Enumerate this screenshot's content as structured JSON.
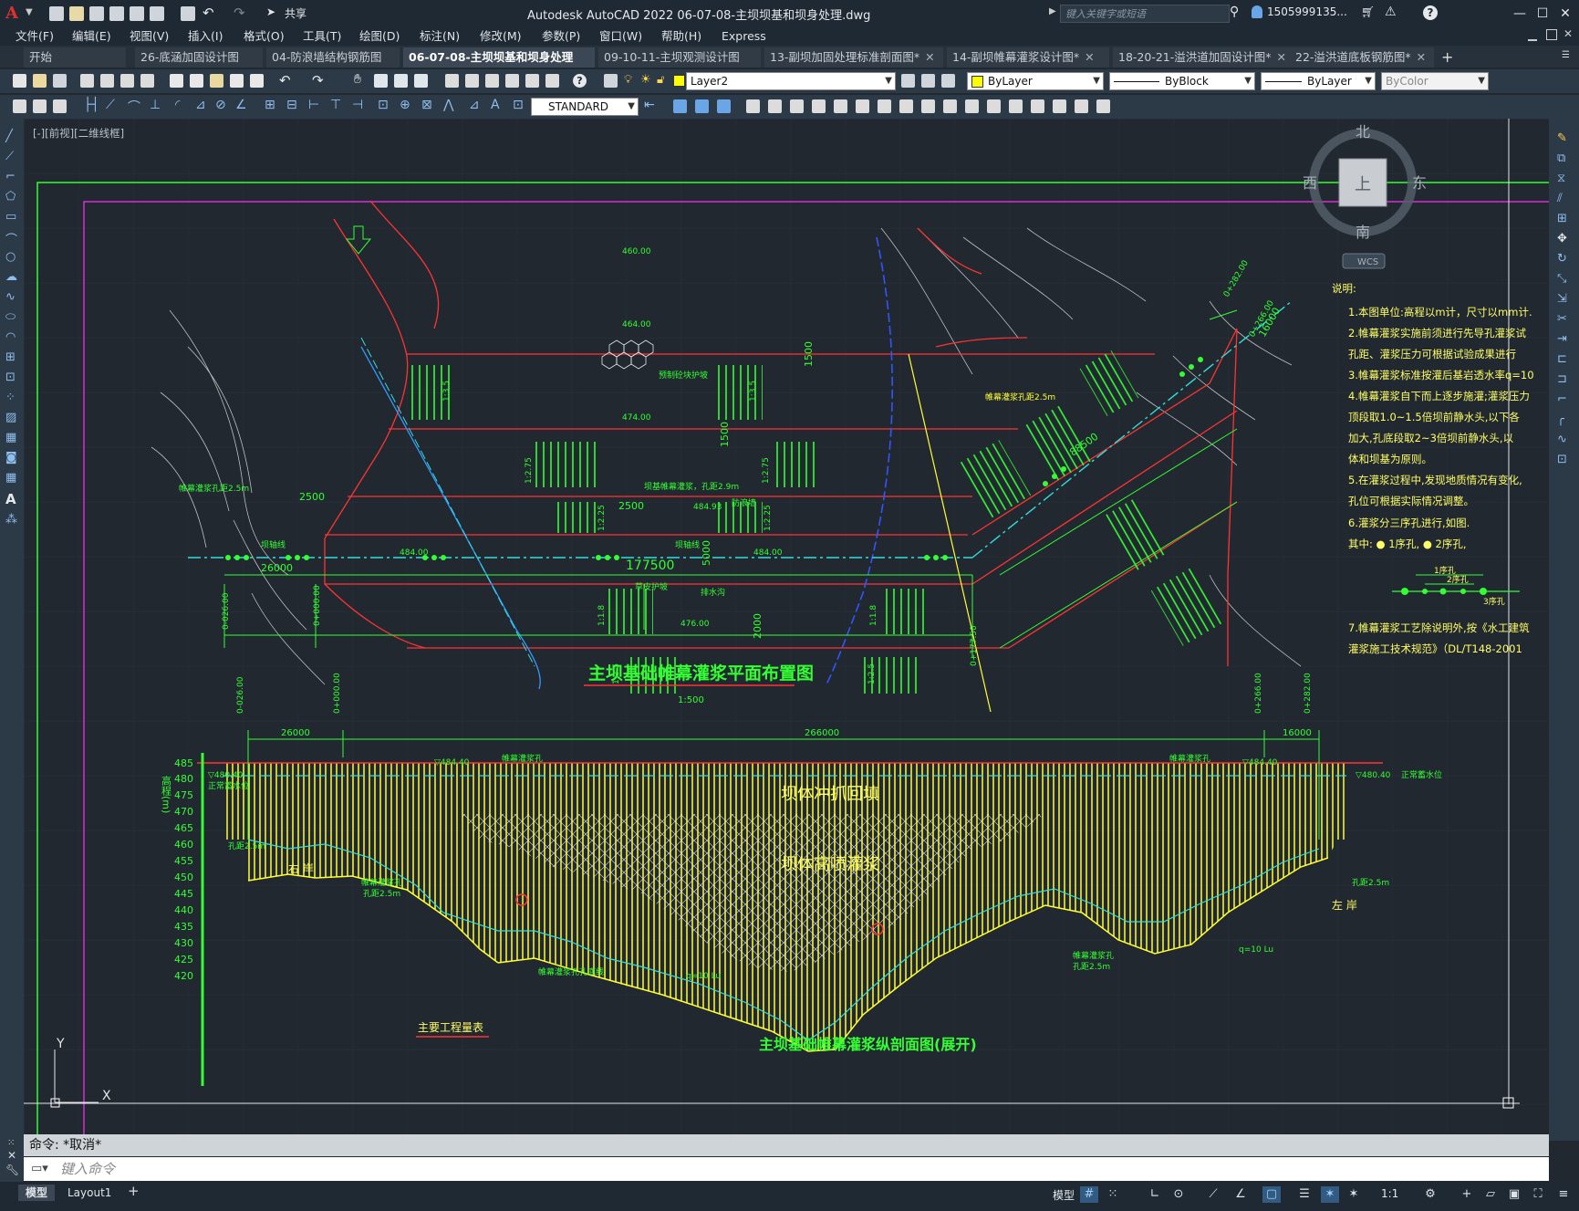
{
  "app": {
    "logo": "A",
    "title": "Autodesk AutoCAD 2022    06-07-08-主坝坝基和坝身处理.dwg",
    "share_label": "共享",
    "search_placeholder": "键入关键字或短语",
    "user": "1505999135...",
    "window_buttons": [
      "—",
      "☐",
      "✕"
    ]
  },
  "menu": [
    "文件(F)",
    "编辑(E)",
    "视图(V)",
    "插入(I)",
    "格式(O)",
    "工具(T)",
    "绘图(D)",
    "标注(N)",
    "修改(M)",
    "参数(P)",
    "窗口(W)",
    "帮助(H)",
    "Express"
  ],
  "tabs": [
    {
      "label": "开始",
      "active": false,
      "closable": false
    },
    {
      "label": "26-底涵加固设计图*",
      "active": false,
      "closable": true
    },
    {
      "label": "04-防浪墙结构钢筋图",
      "active": false,
      "closable": true
    },
    {
      "label": "06-07-08-主坝坝基和坝身处理*",
      "active": true,
      "closable": true
    },
    {
      "label": "09-10-11-主坝观测设计图*",
      "active": false,
      "closable": true
    },
    {
      "label": "13-副坝加固处理标准剖面图*",
      "active": false,
      "closable": true
    },
    {
      "label": "14-副坝帷幕灌浆设计图*",
      "active": false,
      "closable": true
    },
    {
      "label": "18-20-21-溢洪道加固设计图*",
      "active": false,
      "closable": true
    },
    {
      "label": "22-溢洪道底板钢筋图*",
      "active": false,
      "closable": true
    }
  ],
  "properties": {
    "layer": "Layer2",
    "color": "ByLayer",
    "linetype": "ByBlock",
    "lineweight": "ByLayer",
    "plotstyle": "ByColor",
    "textstyle": "STANDARD"
  },
  "viewport_label": "[-][前视][二维线框]",
  "viewcube": {
    "north": "北",
    "south": "南",
    "east": "东",
    "west": "西",
    "top": "上",
    "wcs": "WCS"
  },
  "drawing": {
    "plan_title": "主坝基础帷幕灌浆平面布置图",
    "plan_scale": "1:500",
    "section_title": "主坝基础帷幕灌浆纵剖面图(展开)",
    "quantity_table": "主要工程量表",
    "notes_title": "说明:",
    "notes": [
      "1.本图单位:高程以m计，尺寸以mm计.",
      "2.帷幕灌浆实施前须进行先导孔灌浆试",
      "  孔距、灌浆压力可根据试验成果进行",
      "3.帷幕灌浆标准按灌后基岩透水率q=10",
      "4.帷幕灌浆自下而上逐步施灌;灌浆压力",
      "  顶段取1.0~1.5倍坝前静水头,以下各",
      "  加大,孔底段取2~3倍坝前静水头,以",
      "  体和坝基为原则。",
      "5.在灌浆过程中,发现地质情况有变化,",
      "  孔位可根据实际情况调整。",
      "6.灌浆分三序孔进行,如图.",
      "  其中: ● 1序孔,  ● 2序孔,",
      "7.帷幕灌浆工艺除说明外,按《水工建筑",
      "  灌浆施工技术规范》（DL/T148-2001"
    ],
    "order_labels": [
      "1序孔",
      "2序孔",
      "3序孔"
    ],
    "plan_dims": [
      "26000",
      "2500",
      "2500",
      "177500",
      "5000",
      "1500",
      "1500",
      "2000",
      "16000",
      "88500"
    ],
    "plan_elevs": [
      "460.00",
      "464.00",
      "474.00",
      "484.00",
      "484.00",
      "484.93",
      "476.00"
    ],
    "stations": [
      "0-026.00",
      "0+000.00",
      "0+266.00",
      "0+282.00",
      "0+177.50"
    ],
    "plan_labels": [
      "帷幕灌浆孔距2.5m",
      "坝基帷幕灌浆，孔距2.9m",
      "坝轴线",
      "防浪墙",
      "坝轴线",
      "预制砼块护坡",
      "草皮护坡",
      "排水沟",
      "帷幕灌浆孔距2.5m"
    ],
    "slopes": [
      "1:3.5",
      "1:3.5",
      "1:2.75",
      "1:2.75",
      "1:2.25",
      "1:2.25",
      "1:1.8",
      "1:1.8",
      "1:2.5",
      "1:2.5"
    ],
    "section_dims": [
      "26000",
      "266000",
      "16000"
    ],
    "section_stations": [
      "0-026.00",
      "0+000.00",
      "0+266.00",
      "0+282.00"
    ],
    "axis_label": "高程(m)",
    "axis_values": [
      "485",
      "480",
      "475",
      "470",
      "465",
      "460",
      "455",
      "450",
      "445",
      "440",
      "435",
      "430",
      "425",
      "420"
    ],
    "zone_labels": [
      "坝体冲抓回填",
      "坝体高喷灌浆"
    ],
    "bank_labels": [
      "右  岸",
      "左  岸"
    ],
    "section_labels": [
      "帷幕灌浆孔",
      "孔距2.5m",
      "帷幕灌浆孔",
      "孔距2.5m",
      "帷幕灌浆孔",
      "孔距2.5m",
      "帷幕灌浆孔",
      "孔距2.5m",
      "帷幕灌浆孔孔底线",
      "q=10 Lu",
      "q=10 Lu",
      "▽484.40",
      "▽484.40",
      "▽480.40",
      "正常蓄水位",
      "▽480.40",
      "正常蓄水位"
    ]
  },
  "command": {
    "history": "命令: *取消*",
    "placeholder": "键入命令"
  },
  "status": {
    "layouts": [
      "模型",
      "Layout1"
    ],
    "model_label": "模型",
    "scale": "1:1"
  }
}
